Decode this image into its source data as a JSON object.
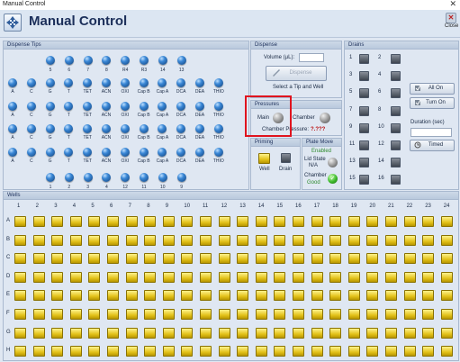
{
  "window": {
    "title": "Manual Control",
    "close_glyph": "✕"
  },
  "header": {
    "title": "Manual Control",
    "close_label": "Close",
    "logo_icon": "directions-icon",
    "close_icon": "close-app-icon"
  },
  "dispense_tips": {
    "title": "Dispense Tips",
    "top_labels": [
      "5",
      "6",
      "7",
      "8",
      "R4",
      "R3",
      "14",
      "13"
    ],
    "row_labels": [
      "A",
      "C",
      "G",
      "T",
      "TET",
      "ACN",
      "OXI",
      "Cap B",
      "Cap A",
      "DCA",
      "DEA",
      "THIO"
    ],
    "bottom_labels": [
      "1",
      "2",
      "3",
      "4",
      "12",
      "11",
      "10",
      "9"
    ]
  },
  "dispense": {
    "title": "Dispense",
    "volume_label": "Volume (µL):",
    "volume_value": "",
    "button_label": "Dispense",
    "hint": "Select a Tip and Well"
  },
  "pressures": {
    "title": "Pressures",
    "main_label": "Main",
    "chamber_label": "Chamber",
    "chamber_pressure_label": "Chamber Pressure:",
    "chamber_pressure_value": "?.???"
  },
  "priming": {
    "title": "Priming",
    "well_label": "Well",
    "drain_label": "Drain"
  },
  "plate_move": {
    "title": "Plate Move",
    "status": "Enabled",
    "lid_state_label": "Lid State",
    "lid_state_value": "N/A",
    "chamber_label": "Chamber",
    "chamber_value": "Good"
  },
  "drains": {
    "title": "Drains",
    "left": [
      "1",
      "3",
      "5",
      "7",
      "9",
      "11",
      "13",
      "15"
    ],
    "right": [
      "2",
      "4",
      "6",
      "8",
      "10",
      "12",
      "14",
      "16"
    ],
    "all_on_label": "All On",
    "turn_on_label": "Turn On",
    "duration_label": "Duration (sec)",
    "duration_value": "",
    "timed_label": "Timed"
  },
  "wells": {
    "title": "Wells",
    "columns": [
      "1",
      "2",
      "3",
      "4",
      "5",
      "6",
      "7",
      "8",
      "9",
      "10",
      "11",
      "12",
      "13",
      "14",
      "15",
      "16",
      "17",
      "18",
      "19",
      "20",
      "21",
      "22",
      "23",
      "24"
    ],
    "rows": [
      "A",
      "B",
      "C",
      "D",
      "E",
      "F",
      "G",
      "H"
    ]
  },
  "colors": {
    "accent": "#1c2f5a",
    "highlight": "#e0141e",
    "tip": "#3b88d6",
    "well": "#e3c21a",
    "status_green": "#2e8b2e"
  }
}
